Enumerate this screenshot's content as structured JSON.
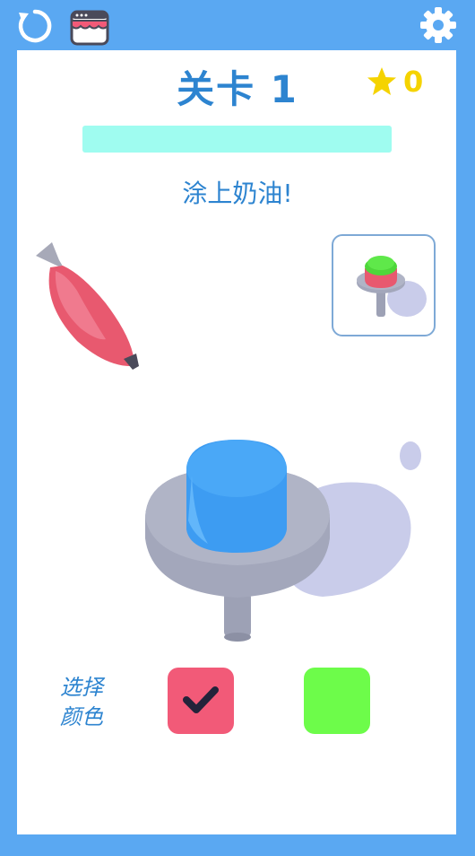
{
  "level": {
    "title": "关卡 1"
  },
  "stars": {
    "count": "0",
    "icon": "star-icon",
    "color": "#f5d300"
  },
  "progress": {
    "fraction": 0.0
  },
  "instruction": "涂上奶油!",
  "color_picker": {
    "label_line1": "选择",
    "label_line2": "颜色",
    "swatches": [
      {
        "color": "#f25a78",
        "selected": true
      },
      {
        "color": "#6dfc4a",
        "selected": false
      }
    ]
  },
  "toolbar": {
    "restart_icon": "restart-icon",
    "shop_icon": "shop-icon",
    "settings_icon": "gear-icon"
  },
  "colors": {
    "background": "#5aa8f2",
    "title": "#2d84d0",
    "cake": "#3d9cf2",
    "stand": "#a8acc2"
  }
}
